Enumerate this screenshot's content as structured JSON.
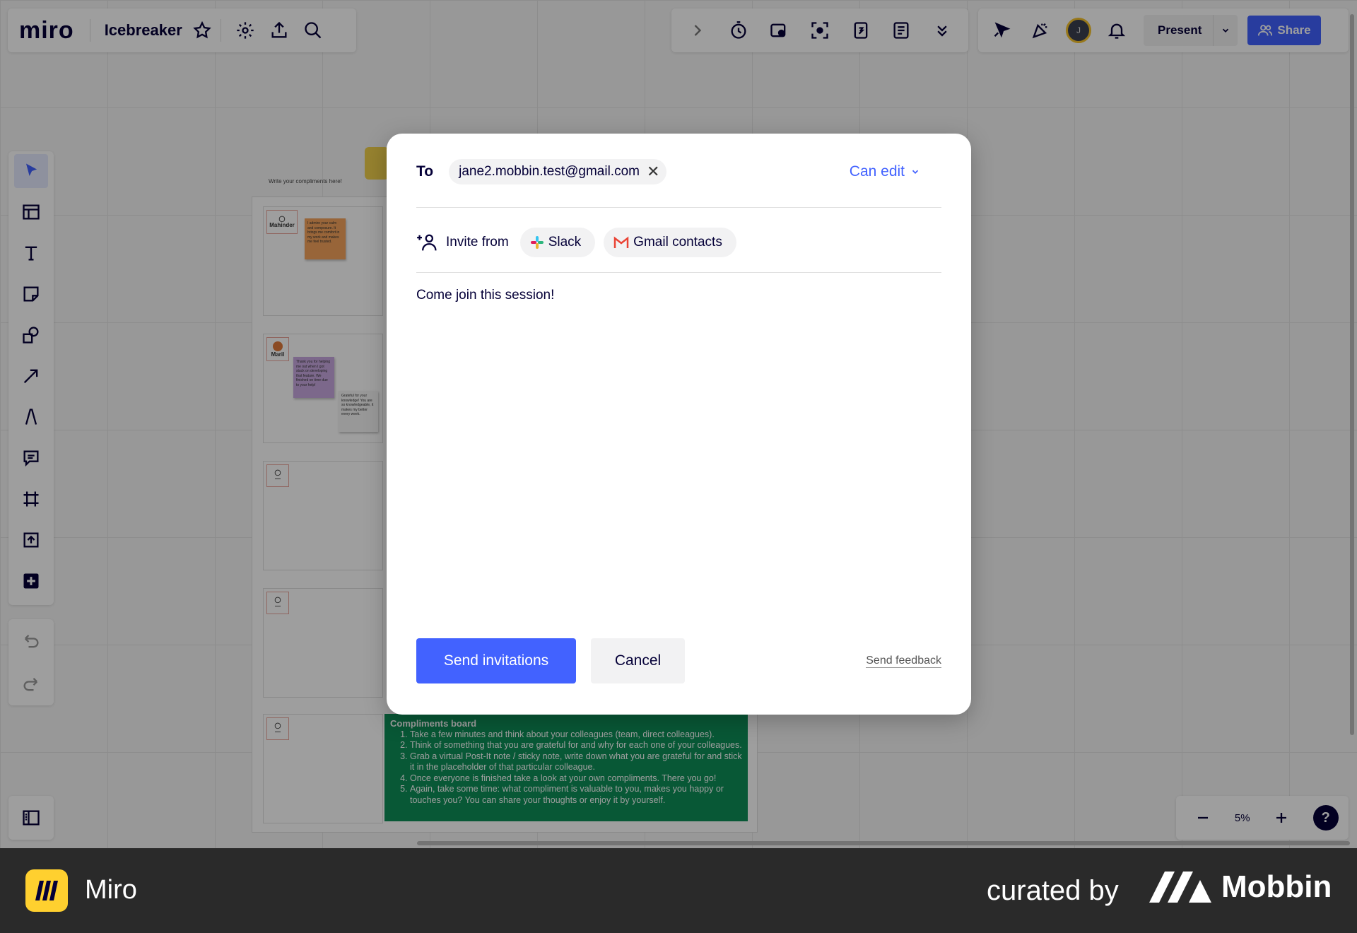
{
  "app": {
    "logo_text": "miro",
    "board_name": "Icebreaker"
  },
  "header": {
    "present_label": "Present",
    "share_label": "Share",
    "avatar_initial": "J"
  },
  "board": {
    "hint": "Write your compliments here!",
    "rows": [
      {
        "name": "Mahinder",
        "note": "I admire your calm and composure. It brings me comfort in my work and makes me feel trusted."
      },
      {
        "name": "Maril",
        "note": "Thank you for helping me out when I got stuck on developing that feature. We finished on time due to your help!",
        "note2": "Grateful for your knowledge! You are so knowledgeable, it makes my better every week."
      },
      {
        "name": "—"
      },
      {
        "name": "—"
      },
      {
        "name": "—"
      }
    ],
    "instructions": {
      "title": "Compliments board",
      "items": [
        "Take a few minutes and think about your colleagues (team, direct colleagues).",
        "Think of something that you are grateful for and why for each one of your colleagues.",
        "Grab a virtual Post-It note / sticky note, write down what you are grateful for and stick it in the placeholder of that particular colleague.",
        "Once everyone is finished take a look at your own compliments. There you go!",
        "Again, take some time: what compliment is valuable to you, makes you happy or touches you? You can share your thoughts or enjoy it by yourself."
      ]
    }
  },
  "zoom": {
    "level": "5%"
  },
  "modal": {
    "to_label": "To",
    "recipient": "jane2.mobbin.test@gmail.com",
    "permission": "Can edit",
    "invite_from_label": "Invite from",
    "sources": [
      "Slack",
      "Gmail contacts"
    ],
    "message": "Come join this session!",
    "send_label": "Send invitations",
    "cancel_label": "Cancel",
    "feedback_label": "Send feedback"
  },
  "footer": {
    "app_name": "Miro",
    "curated_label": "curated by",
    "brand": "Mobbin"
  },
  "colors": {
    "accent": "#4262ff",
    "sticky_orange": "#f5a45c",
    "sticky_purple": "#c9a9e0",
    "instructions_bg": "#0d8f58",
    "footer_bg": "#2a2a2a"
  }
}
